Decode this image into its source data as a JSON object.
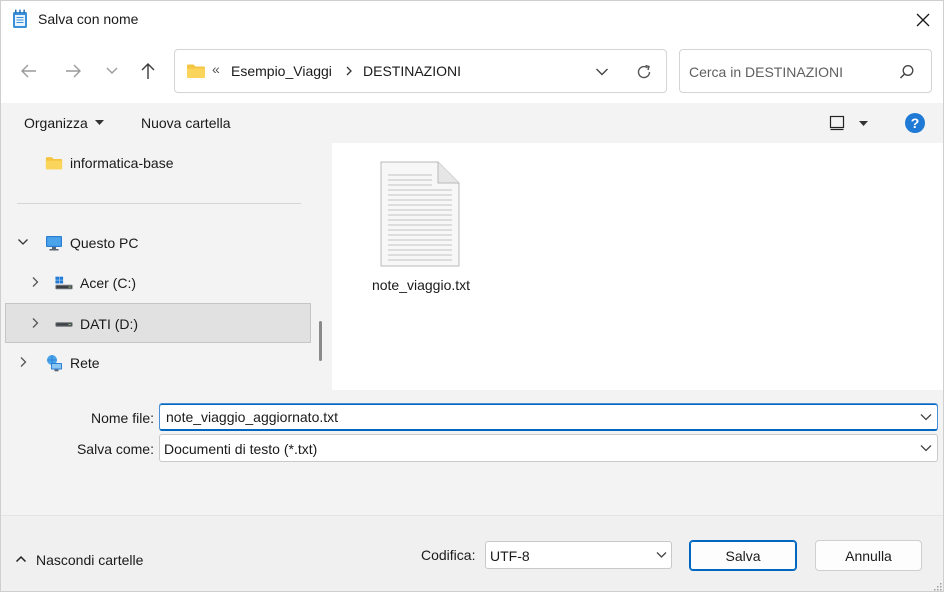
{
  "window": {
    "title": "Salva con nome"
  },
  "address": {
    "overflow_chevron": "«",
    "crumbs": [
      "Esempio_Viaggi",
      "DESTINAZIONI"
    ]
  },
  "search": {
    "placeholder": "Cerca in DESTINAZIONI"
  },
  "toolbar": {
    "organize_label": "Organizza",
    "new_folder_label": "Nuova cartella",
    "help_label": "?"
  },
  "navpane": {
    "items": [
      {
        "label": "informatica-base",
        "icon": "folder-icon",
        "expander": ""
      },
      {
        "label": "Questo PC",
        "icon": "computer-icon",
        "expander": "expanded"
      },
      {
        "label": "Acer (C:)",
        "icon": "windows-drive-icon",
        "expander": "collapsed"
      },
      {
        "label": "DATI (D:)",
        "icon": "drive-icon",
        "expander": "collapsed",
        "selected": true
      },
      {
        "label": "Rete",
        "icon": "network-icon",
        "expander": "collapsed"
      }
    ]
  },
  "files": [
    {
      "name": "note_viaggio.txt",
      "icon": "text-file-icon"
    }
  ],
  "form": {
    "filename_label": "Nome file:",
    "filename_value": "note_viaggio_aggiornato.txt",
    "savetype_label": "Salva come:",
    "savetype_value": "Documenti di testo (*.txt)"
  },
  "footer": {
    "hide_folders_label": "Nascondi cartelle",
    "encoding_label": "Codifica:",
    "encoding_value": "UTF-8",
    "save_label": "Salva",
    "cancel_label": "Annulla"
  },
  "colors": {
    "accent": "#0067c0",
    "selection": "#e1e1e1",
    "help": "#1f7ad6",
    "folder": "#f5c542"
  }
}
